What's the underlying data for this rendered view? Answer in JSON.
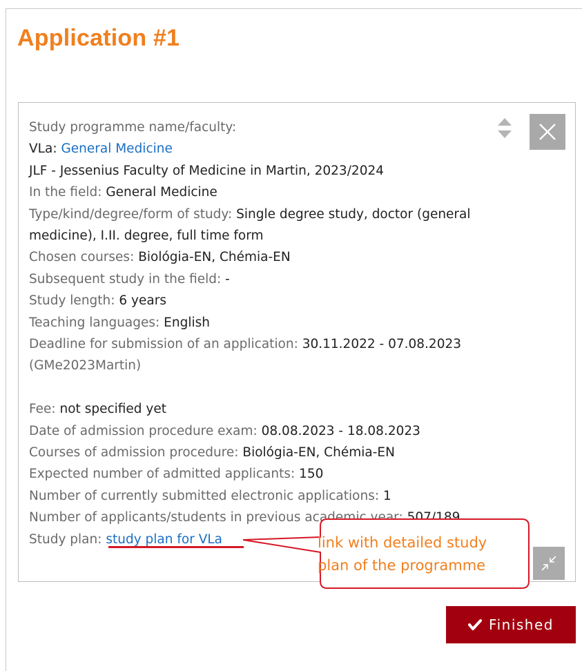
{
  "page": {
    "title": "Application #1"
  },
  "programme": {
    "name_label": "Study programme name/faculty:",
    "code": "VLa",
    "code_sep": ": ",
    "name_link": "General Medicine",
    "faculty_line": "JLF - Jessenius Faculty of Medicine in Martin, 2023/2024",
    "fields": [
      {
        "label": "In the field: ",
        "value": "General Medicine"
      },
      {
        "label": "Type/kind/degree/form of study: ",
        "value": "Single degree study, doctor (general medicine), I.II. degree, full time form"
      },
      {
        "label": "Chosen courses: ",
        "value": "Biológia-EN, Chémia-EN"
      },
      {
        "label": "Subsequent study in the field: ",
        "value": "-"
      },
      {
        "label": "Study length: ",
        "value": "6 years"
      },
      {
        "label": "Teaching languages: ",
        "value": "English"
      },
      {
        "label": "Deadline for submission of an application: ",
        "value": "30.11.2022 - 07.08.2023",
        "extra": " (GMe2023Martin)"
      }
    ],
    "fields2": [
      {
        "label": "Fee: ",
        "value": "not specified yet"
      },
      {
        "label": "Date of admission procedure exam: ",
        "value": "08.08.2023 - 18.08.2023"
      },
      {
        "label": "Courses of admission procedure: ",
        "value": "Biológia-EN, Chémia-EN"
      },
      {
        "label": "Expected number of admitted applicants: ",
        "value": "150"
      },
      {
        "label": "Number of currently submitted electronic applications: ",
        "value": "1"
      },
      {
        "label": "Number of applicants/students in previous academic year: ",
        "value": "507/189"
      }
    ],
    "study_plan_label": "Study plan: ",
    "study_plan_link": "study plan for VLa"
  },
  "annotation": {
    "callout_line1": "link with detailed study",
    "callout_line2": "plan of the programme",
    "color": "#f07f1e",
    "underline_color": "#d51826"
  },
  "actions": {
    "finished_label": "Finished",
    "finished_icon": "check-icon",
    "finished_color": "#a3000f"
  },
  "icons": {
    "close": "close-icon",
    "collapse": "collapse-icon",
    "sort": "sort-arrows-icon"
  }
}
